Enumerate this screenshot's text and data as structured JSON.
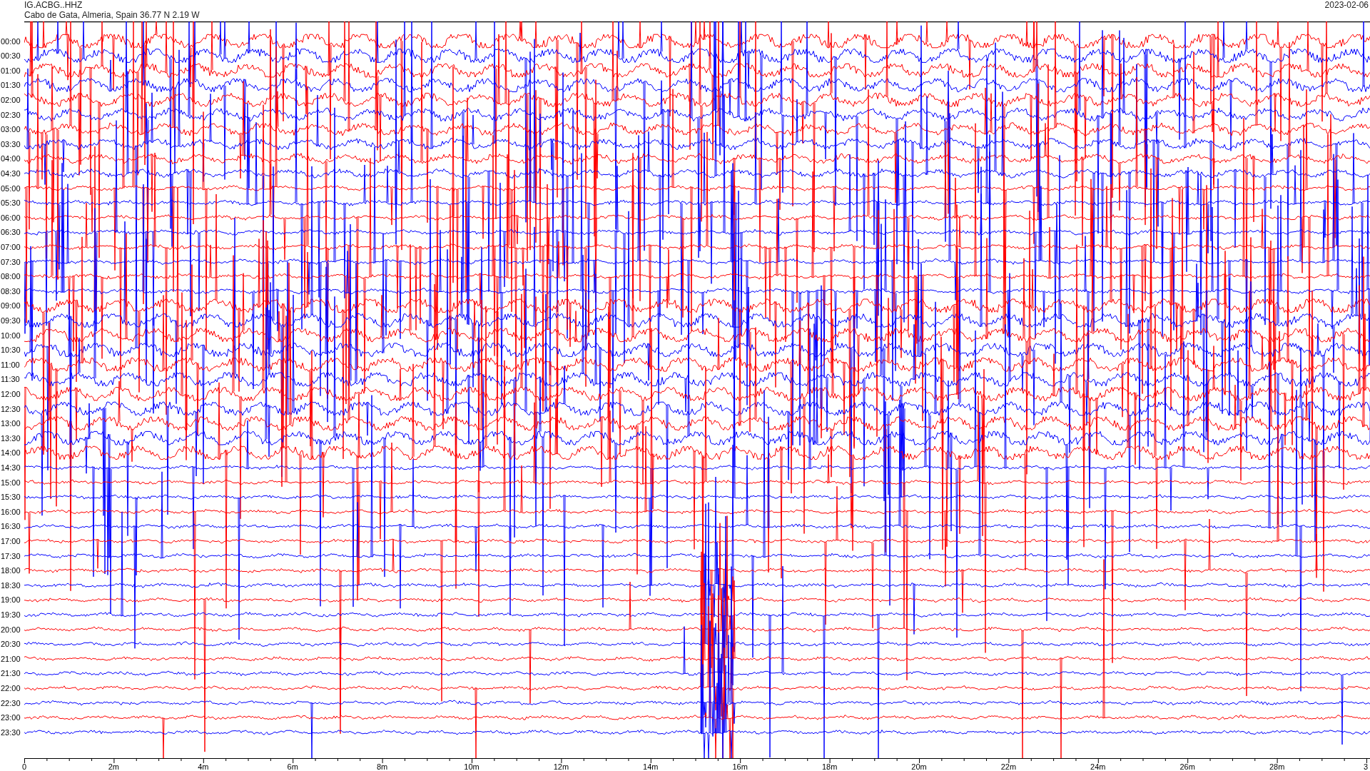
{
  "header": {
    "station": "IG.ACBG..HHZ",
    "location": "Cabo de Gata, Almeria, Spain  36.77 N 2.19 W",
    "date": "2023-02-06"
  },
  "hour_labels": [
    "00:00",
    "00:30",
    "01:00",
    "01:30",
    "02:00",
    "02:30",
    "03:00",
    "03:30",
    "04:00",
    "04:30",
    "05:00",
    "05:30",
    "06:00",
    "06:30",
    "07:00",
    "07:30",
    "08:00",
    "08:30",
    "09:00",
    "09:30",
    "10:00",
    "10:30",
    "11:00",
    "11:30",
    "12:00",
    "12:30",
    "13:00",
    "13:30",
    "14:00",
    "14:30",
    "15:00",
    "15:30",
    "16:00",
    "16:30",
    "17:00",
    "17:30",
    "18:00",
    "18:30",
    "19:00",
    "19:30",
    "20:00",
    "20:30",
    "21:00",
    "21:30",
    "22:00",
    "22:30",
    "23:00",
    "23:30"
  ],
  "x_axis": {
    "ticks": [
      "0",
      "2m",
      "4m",
      "6m",
      "8m",
      "10m",
      "12m",
      "14m",
      "16m",
      "18m",
      "20m",
      "22m",
      "24m",
      "26m",
      "28m",
      "3"
    ]
  }
}
